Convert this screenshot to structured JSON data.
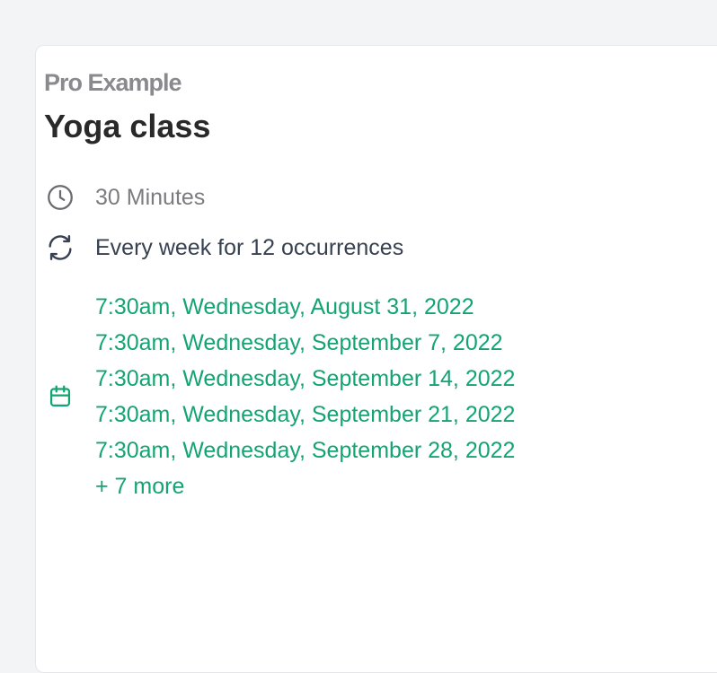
{
  "event": {
    "owner": "Pro Example",
    "title": "Yoga class",
    "duration": "30 Minutes",
    "recurrence": "Every week for 12 occurrences",
    "dates": [
      "7:30am, Wednesday, August 31, 2022",
      "7:30am, Wednesday, September 7, 2022",
      "7:30am, Wednesday, September 14, 2022",
      "7:30am, Wednesday, September 21, 2022",
      "7:30am, Wednesday, September 28, 2022"
    ],
    "more": "+ 7 more"
  },
  "icons": {
    "duration": "clock-icon",
    "recurrence": "refresh-icon",
    "dates": "calendar-icon"
  },
  "colors": {
    "accent_green": "#14a472",
    "title": "#292929",
    "muted": "#8a8a8e"
  }
}
